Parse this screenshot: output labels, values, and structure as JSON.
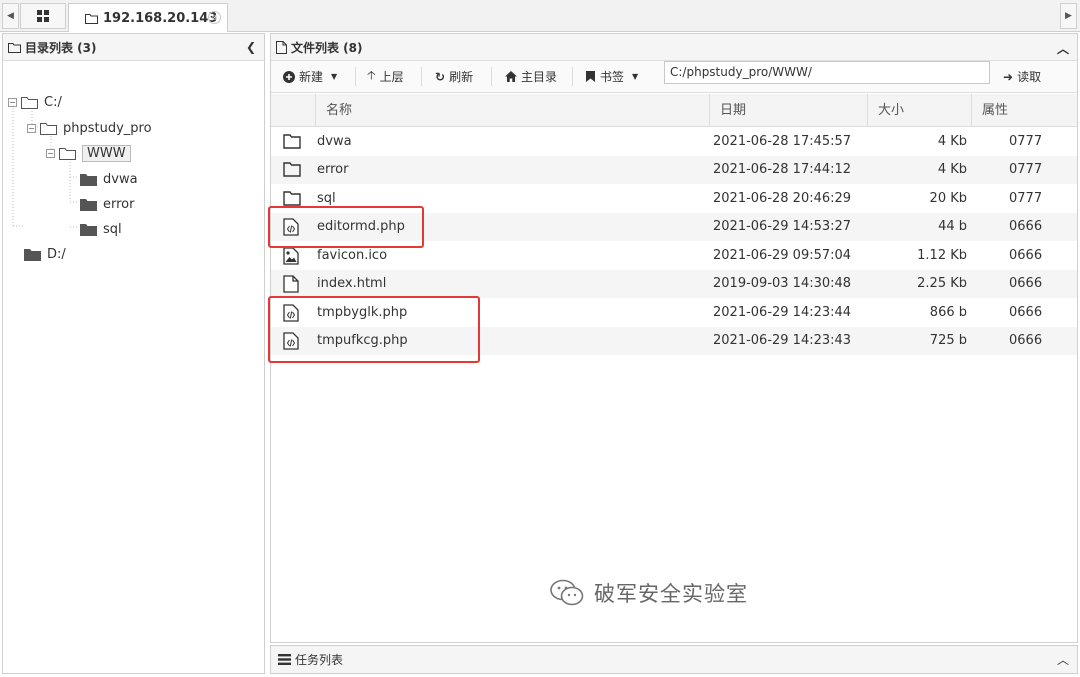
{
  "tabbar": {
    "tab_title": "192.168.20.143",
    "close_symbol": "⊗"
  },
  "left": {
    "title": "目录列表 (3)",
    "tree": {
      "c_drive": "C:/",
      "phpstudy": "phpstudy_pro",
      "www": "WWW",
      "dvwa": "dvwa",
      "error": "error",
      "sql": "sql",
      "d_drive": "D:/"
    }
  },
  "right": {
    "title": "文件列表 (8)",
    "toolbar": {
      "new_label": "新建",
      "up_label": "上层",
      "refresh_label": "刷新",
      "home_label": "主目录",
      "bookmark_label": "书签",
      "path": "C:/phpstudy_pro/WWW/",
      "read_label": "读取"
    },
    "columns": {
      "name": "名称",
      "date": "日期",
      "size": "大小",
      "attr": "属性"
    },
    "files": [
      {
        "icon": "folder-icon",
        "name": "dvwa",
        "date": "2021-06-28 17:45:57",
        "size": "4 Kb",
        "attr": "0777"
      },
      {
        "icon": "folder-icon",
        "name": "error",
        "date": "2021-06-28 17:44:12",
        "size": "4 Kb",
        "attr": "0777"
      },
      {
        "icon": "folder-icon",
        "name": "sql",
        "date": "2021-06-28 20:46:29",
        "size": "20 Kb",
        "attr": "0777"
      },
      {
        "icon": "code-file-icon",
        "name": "editormd.php",
        "date": "2021-06-29 14:53:27",
        "size": "44 b",
        "attr": "0666"
      },
      {
        "icon": "image-file-icon",
        "name": "favicon.ico",
        "date": "2021-06-29 09:57:04",
        "size": "1.12 Kb",
        "attr": "0666"
      },
      {
        "icon": "file-icon",
        "name": "index.html",
        "date": "2019-09-03 14:30:48",
        "size": "2.25 Kb",
        "attr": "0666"
      },
      {
        "icon": "code-file-icon",
        "name": "tmpbyglk.php",
        "date": "2021-06-29 14:23:44",
        "size": "866 b",
        "attr": "0666"
      },
      {
        "icon": "code-file-icon",
        "name": "tmpufkcg.php",
        "date": "2021-06-29 14:23:43",
        "size": "725 b",
        "attr": "0666"
      }
    ]
  },
  "task_bar": {
    "title": "任务列表"
  },
  "watermark": {
    "text": "破军安全实验室"
  },
  "colors": {
    "highlight": "#e53935"
  }
}
